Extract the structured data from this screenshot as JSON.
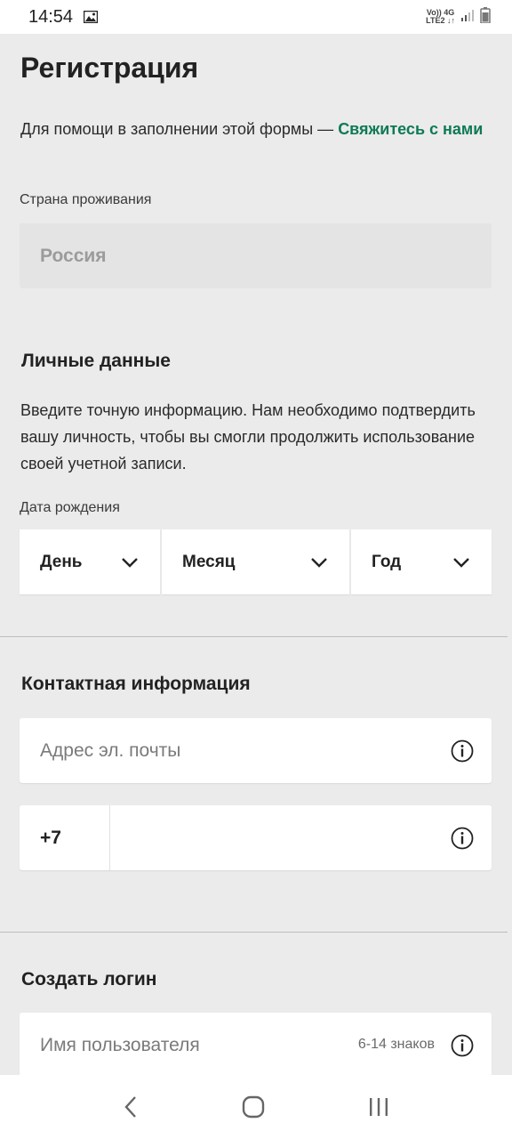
{
  "status": {
    "time": "14:54",
    "net_top": "Vo)) 4G",
    "net_bottom": "LTE2 ↓↑"
  },
  "page": {
    "title": "Регистрация",
    "help_text": "Для помощи в заполнении этой формы — ",
    "help_link": "Свяжитесь с нами"
  },
  "country": {
    "label": "Страна проживания",
    "value": "Россия"
  },
  "personal": {
    "title": "Личные данные",
    "description": "Введите точную информацию. Нам необходимо подтвердить вашу личность, чтобы вы смогли продолжить использование своей учетной записи.",
    "dob_label": "Дата рождения",
    "day": "День",
    "month": "Месяц",
    "year": "Год"
  },
  "contact": {
    "title": "Контактная информация",
    "email_placeholder": "Адрес эл. почты",
    "phone_prefix": "+7"
  },
  "login": {
    "title": "Создать логин",
    "username_placeholder": "Имя пользователя",
    "username_hint": "6-14 знаков"
  },
  "colors": {
    "accent": "#0e7a55",
    "background": "#ebebeb"
  },
  "icons": [
    "gallery-icon",
    "signal-icon",
    "battery-icon",
    "chevron-down-icon",
    "info-icon",
    "nav-back-icon",
    "nav-home-icon",
    "nav-recents-icon"
  ]
}
